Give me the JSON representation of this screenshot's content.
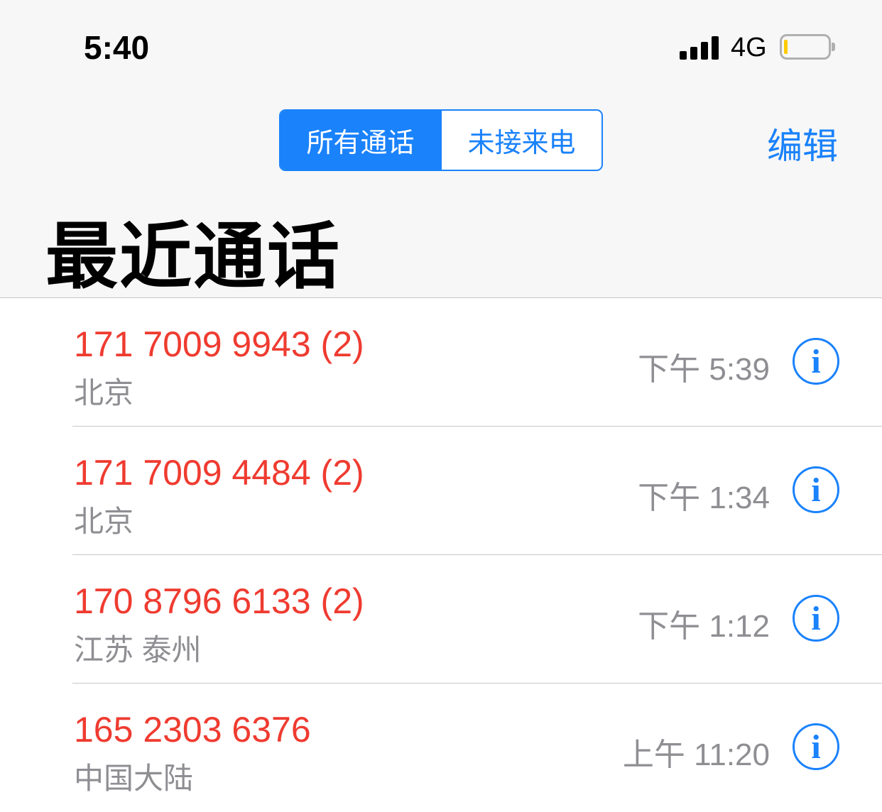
{
  "status_bar": {
    "time": "5:40",
    "network": "4G",
    "signal_bars": 4,
    "battery_level": 0.08
  },
  "header": {
    "segments": [
      "所有通话",
      "未接来电"
    ],
    "active_segment": 0,
    "edit_label": "编辑",
    "title": "最近通话"
  },
  "calls": [
    {
      "number": "171 7009 9943 (2)",
      "location": "北京",
      "time": "下午 5:39",
      "info_icon": "i"
    },
    {
      "number": "171 7009 4484 (2)",
      "location": "北京",
      "time": "下午 1:34",
      "info_icon": "i"
    },
    {
      "number": "170 8796 6133 (2)",
      "location": "江苏 泰州",
      "time": "下午 1:12",
      "info_icon": "i"
    },
    {
      "number": "165 2303 6376",
      "location": "中国大陆",
      "time": "上午 11:20",
      "info_icon": "i"
    }
  ],
  "colors": {
    "accent": "#1a82fb",
    "missed_call": "#ef3b30",
    "secondary_text": "#8e8e93",
    "header_bg": "#f7f7f7"
  }
}
